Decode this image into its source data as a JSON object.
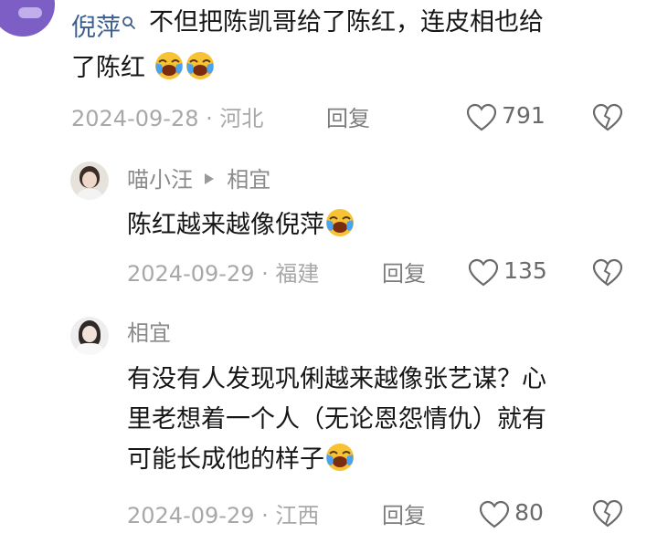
{
  "comment1": {
    "author": "倪萍",
    "text_line1": "不但把陈凯哥给了陈红，连皮相也给",
    "text_line2": "了陈红",
    "date_location": "2024-09-28 · 河北",
    "reply_label": "回复",
    "likes": "791"
  },
  "reply1": {
    "author": "喵小汪",
    "reply_to": "相宜",
    "text": "陈红越来越像倪萍",
    "date_location": "2024-09-29 · 福建",
    "reply_label": "回复",
    "likes": "135"
  },
  "reply2": {
    "author": "相宜",
    "text_line1": "有没有人发现巩俐越来越像张艺谋？心",
    "text_line2": "里老想着一个人（无论恩怨情仇）就有",
    "text_line3": "可能长成他的样子",
    "date_location": "2024-09-29 · 江西",
    "reply_label": "回复",
    "likes": "80"
  },
  "colors": {
    "author_blue": "#3b5f8f",
    "meta_gray": "#a8a8a8",
    "emoji_yellow": "#f7c234",
    "emoji_blue": "#4aa3f0"
  }
}
